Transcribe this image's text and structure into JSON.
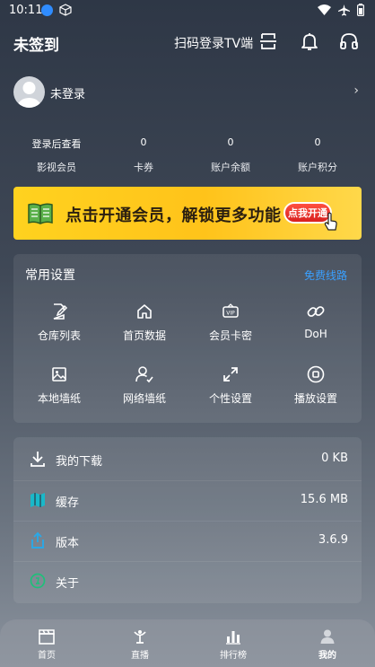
{
  "status": {
    "time": "10:11"
  },
  "header": {
    "title": "未签到",
    "scan_label": "扫码登录TV端"
  },
  "user": {
    "name": "未登录"
  },
  "stats": [
    {
      "value": "登录后查看",
      "label": "影视会员"
    },
    {
      "value": "0",
      "label": "卡券"
    },
    {
      "value": "0",
      "label": "账户余额"
    },
    {
      "value": "0",
      "label": "账户积分"
    }
  ],
  "banner": {
    "text": "点击开通会员，解锁更多功能",
    "button": "点我开通"
  },
  "settings": {
    "title": "常用设置",
    "link": "免费线路",
    "items": [
      {
        "label": "仓库列表",
        "icon": "edit-icon"
      },
      {
        "label": "首页数据",
        "icon": "home-icon"
      },
      {
        "label": "会员卡密",
        "icon": "vip-icon"
      },
      {
        "label": "DoH",
        "icon": "link-icon"
      },
      {
        "label": "本地墙纸",
        "icon": "image-icon"
      },
      {
        "label": "网络墙纸",
        "icon": "user-check-icon"
      },
      {
        "label": "个性设置",
        "icon": "expand-icon"
      },
      {
        "label": "播放设置",
        "icon": "record-icon"
      }
    ]
  },
  "list": [
    {
      "label": "我的下载",
      "value": "0 KB",
      "icon": "download-icon"
    },
    {
      "label": "缓存",
      "value": "15.6 MB",
      "icon": "map-icon"
    },
    {
      "label": "版本",
      "value": "3.6.9",
      "icon": "share-icon"
    },
    {
      "label": "关于",
      "value": "",
      "icon": "info-icon"
    }
  ],
  "nav": [
    {
      "label": "首页"
    },
    {
      "label": "直播"
    },
    {
      "label": "排行榜"
    },
    {
      "label": "我的"
    }
  ]
}
